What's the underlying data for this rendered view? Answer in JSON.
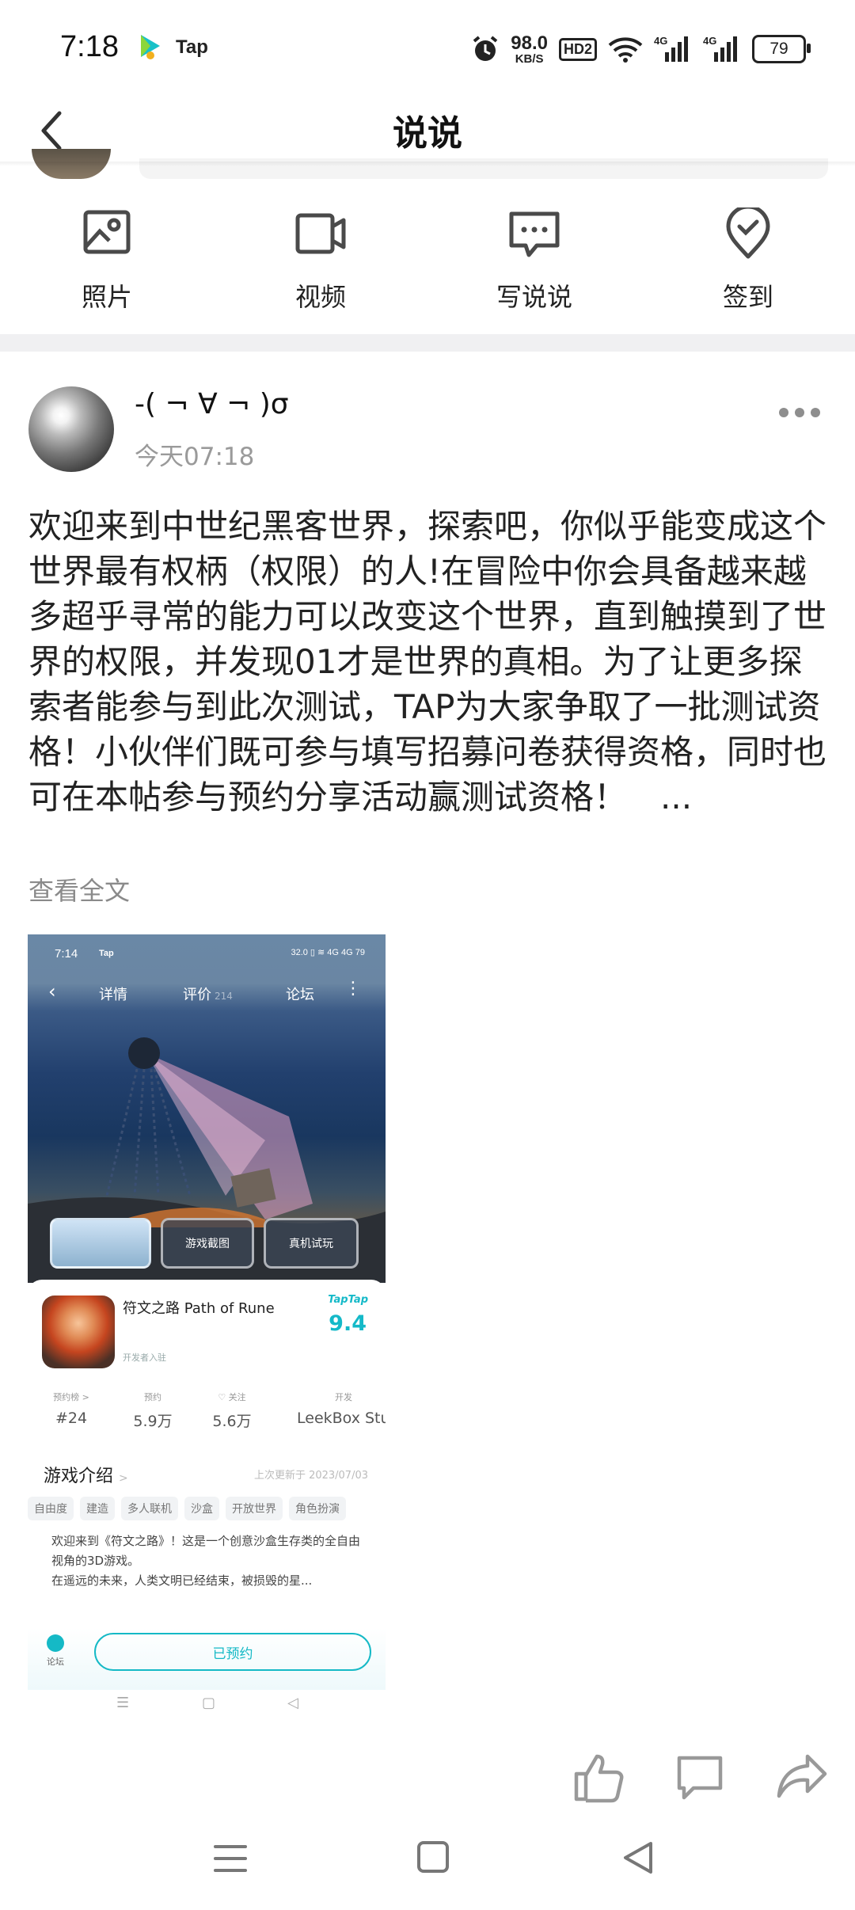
{
  "status_bar": {
    "time": "7:18",
    "app_label": "Tap",
    "net_speed_value": "98.0",
    "net_speed_unit": "KB/S",
    "hd_badge": "HD2",
    "signal_label_1": "4G",
    "signal_label_2": "4G",
    "battery": "79"
  },
  "header": {
    "title": "说说"
  },
  "actions": [
    {
      "label": "照片",
      "icon": "photo-icon"
    },
    {
      "label": "视频",
      "icon": "video-icon"
    },
    {
      "label": "写说说",
      "icon": "chat-bubble-icon"
    },
    {
      "label": "签到",
      "icon": "checkin-location-icon"
    }
  ],
  "post": {
    "username": "-( ¬ ∀ ¬ )σ",
    "time": "今天07:18",
    "text": "欢迎来到中世纪黑客世界，探索吧，你似乎能变成这个世界最有权柄（权限）的人!在冒险中你会具备越来越多超乎寻常的能力可以改变这个世界，直到触摸到了世界的权限，并发现01才是世界的真相。为了让更多探索者能参与到此次测试，TAP为大家争取了一批测试资格！小伙伴们既可参与填写招募问卷获得资格，同时也可在本帖参与预约分享活动赢测试资格！　...",
    "read_more": "查看全文"
  },
  "screenshot": {
    "status_time": "7:14",
    "status_app": "Tap",
    "status_right": "32.0 ▯ ≋ 4G 4G 79",
    "tabs": {
      "detail": "详情",
      "review": "评价",
      "review_count": "214",
      "forum": "论坛"
    },
    "thumb_labels": [
      "游戏截图",
      "真机试玩"
    ],
    "game_name": "符文之路 Path of Rune",
    "developer_note": "开发者入驻",
    "brand": "TapTap",
    "score": "9.4",
    "stats": [
      {
        "key": "预约榜 >",
        "value": "#24"
      },
      {
        "key": "预约",
        "value": "5.9万"
      },
      {
        "key": "♡ 关注",
        "value": "5.6万"
      },
      {
        "key": "开发",
        "value": "LeekBox Stud"
      }
    ],
    "section_title": "游戏介绍",
    "section_chevron": ">",
    "updated": "上次更新于 2023/07/03",
    "tags": [
      "自由度",
      "建造",
      "多人联机",
      "沙盒",
      "开放世界",
      "角色扮演"
    ],
    "description": "欢迎来到《符文之路》！这是一个创意沙盒生存类的全自由视角的3D游戏。\n在遥远的未来，人类文明已经结束，被损毁的星...",
    "forum_label": "论坛",
    "reserve_button": "已预约"
  }
}
